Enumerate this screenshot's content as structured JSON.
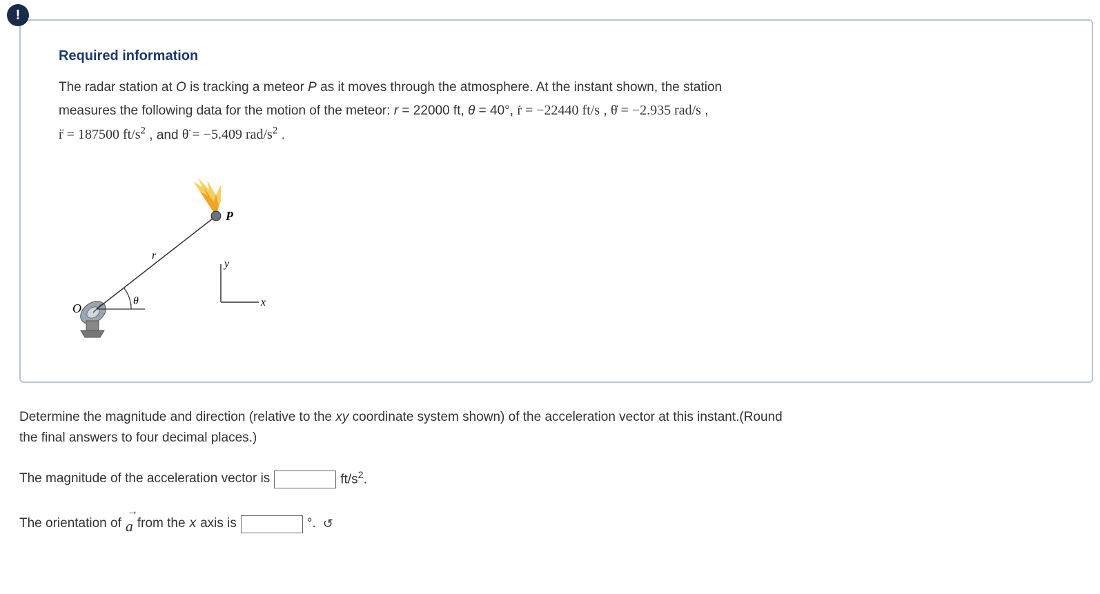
{
  "alert_symbol": "!",
  "required_header": "Required information",
  "problem": {
    "line1_a": "The radar station at ",
    "line1_b": " is tracking a meteor ",
    "line1_c": " as it moves through the atmosphere. At the instant shown, the station",
    "var_O": "O",
    "var_P": "P",
    "line2_a": "measures the following data for the motion of the meteor: ",
    "r_eq": "r",
    "r_val": " = 22000 ft, ",
    "theta_sym": "θ",
    "theta_val": " = 40°, ",
    "rdot": "ṙ = −22440  ft/s",
    "comma1": " , ",
    "thetadot": "θ̇ = −2.935 rad/s",
    "comma2": " ,",
    "rddot_a": "r̈ = 187500 ft/s",
    "rddot_exp": "2",
    "and_text": " , and ",
    "thetaddot_a": "θ̈ = −5.409 rad/s",
    "thetaddot_exp": "2",
    "period": " ."
  },
  "diagram": {
    "label_O": "O",
    "label_P": "P",
    "label_r": "r",
    "label_theta": "θ",
    "label_x": "x",
    "label_y": "y"
  },
  "question": {
    "prompt_a": "Determine the magnitude and direction (relative to the ",
    "xy": "xy",
    "prompt_b": " coordinate system shown) of the acceleration vector at this instant.(Round",
    "prompt_c": "the final answers to four decimal places.)"
  },
  "answer1": {
    "label": "The magnitude of the acceleration vector is ",
    "unit_a": " ft/s",
    "unit_exp": "2",
    "unit_end": "."
  },
  "answer2": {
    "label_a": "The orientation of ",
    "vec": "a",
    "label_b": "  from the ",
    "x": "x",
    "label_c": " axis is ",
    "unit": " °. "
  }
}
